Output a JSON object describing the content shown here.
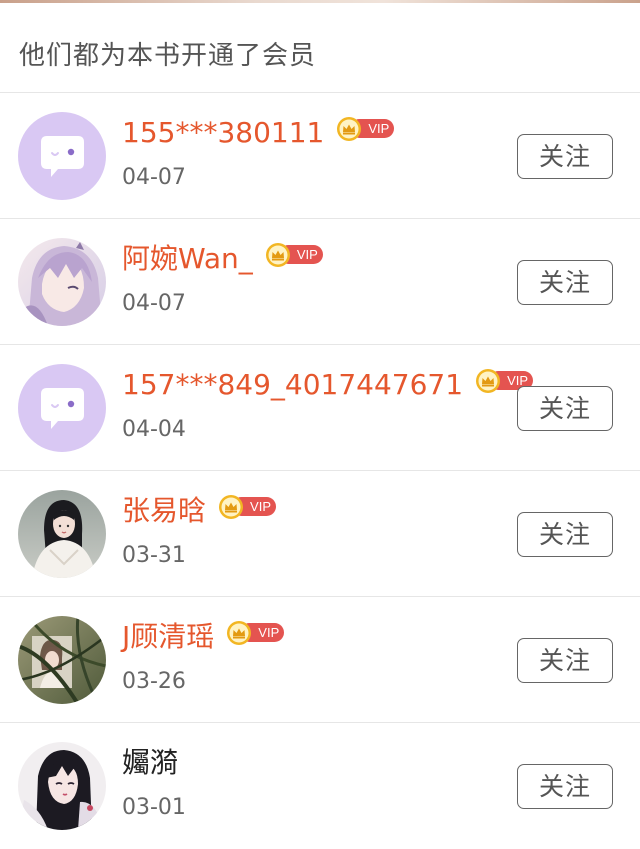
{
  "header": {
    "title": "他们都为本书开通了会员"
  },
  "vip_badge_label": "VIP",
  "follow_label": "关注",
  "members": [
    {
      "name": "155***380111",
      "date": "04-07",
      "vip": true,
      "avatar": "default-chat-avatar"
    },
    {
      "name": "阿婉Wan_",
      "date": "04-07",
      "vip": true,
      "avatar": "anime-girl-avatar"
    },
    {
      "name": "157***849_4017447671",
      "date": "04-04",
      "vip": true,
      "avatar": "default-chat-avatar"
    },
    {
      "name": "张易晗",
      "date": "03-31",
      "vip": true,
      "avatar": "photo-girl-white-dress-avatar"
    },
    {
      "name": "J顾清瑶",
      "date": "03-26",
      "vip": true,
      "avatar": "photo-girl-plants-avatar"
    },
    {
      "name": "孎漪",
      "date": "03-01",
      "vip": false,
      "avatar": "anime-dark-hair-avatar"
    }
  ],
  "colors": {
    "vip_name": "#e5572d",
    "regular_name": "#222222",
    "vip_badge": "#e45450",
    "crown": "#f2b623",
    "default_avatar_bg": "#d9c8f3"
  }
}
